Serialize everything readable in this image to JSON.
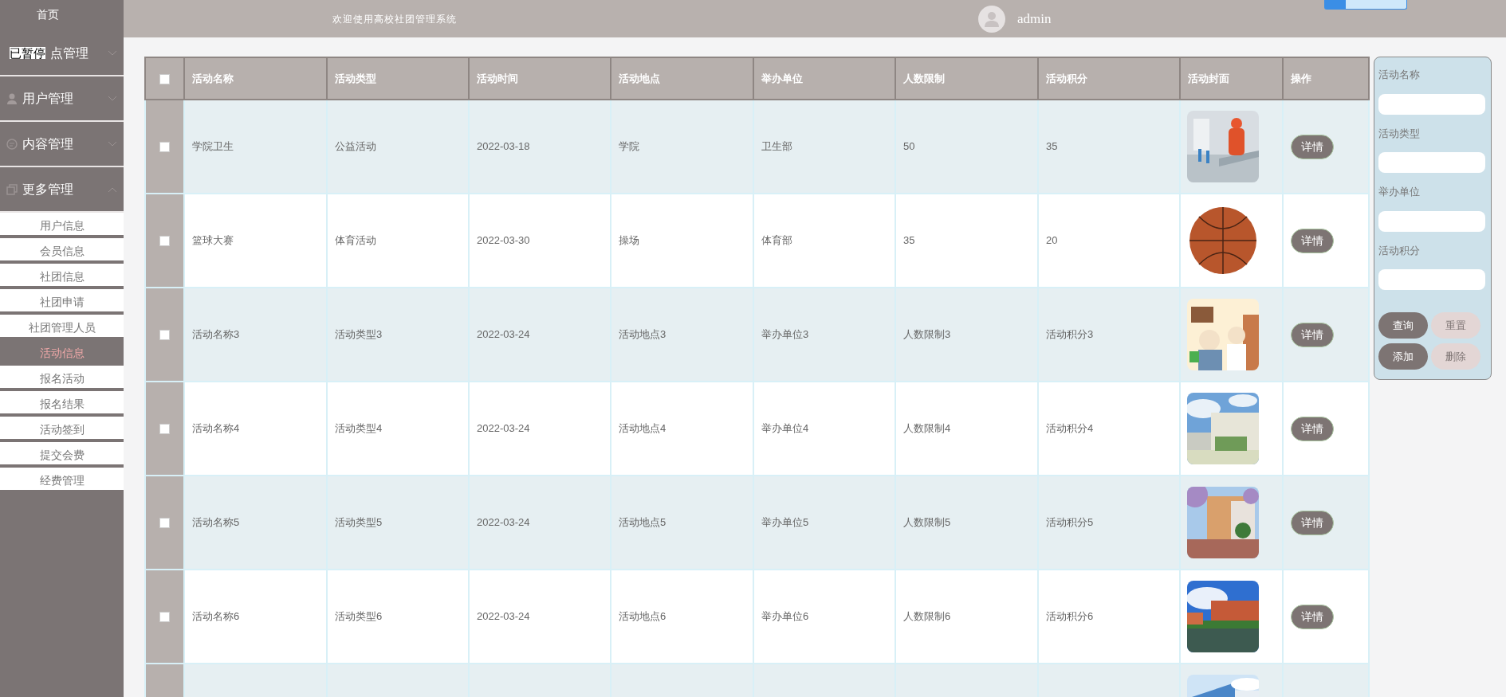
{
  "sidebar": {
    "home": "首页",
    "overlay": "已暂停",
    "groups": [
      {
        "label": "点管理",
        "expanded": false
      },
      {
        "label": "用户管理",
        "expanded": false
      },
      {
        "label": "内容管理",
        "expanded": false
      },
      {
        "label": "更多管理",
        "expanded": true,
        "items": [
          {
            "label": "用户信息",
            "selected": false
          },
          {
            "label": "会员信息",
            "selected": false
          },
          {
            "label": "社团信息",
            "selected": false
          },
          {
            "label": "社团申请",
            "selected": false
          },
          {
            "label": "社团管理人员",
            "selected": false
          },
          {
            "label": "活动信息",
            "selected": true
          },
          {
            "label": "报名活动",
            "selected": false
          },
          {
            "label": "报名结果",
            "selected": false
          },
          {
            "label": "活动签到",
            "selected": false
          },
          {
            "label": "提交会费",
            "selected": false
          },
          {
            "label": "经费管理",
            "selected": false
          }
        ]
      }
    ]
  },
  "header": {
    "title": "欢迎使用高校社团管理系统",
    "user": "admin"
  },
  "table": {
    "select_all_checked": false,
    "columns": [
      "活动名称",
      "活动类型",
      "活动时间",
      "活动地点",
      "举办单位",
      "人数限制",
      "活动积分",
      "活动封面",
      "操作"
    ],
    "rows": [
      {
        "checked": false,
        "cells": [
          "学院卫生",
          "公益活动",
          "2022-03-18",
          "学院",
          "卫生部",
          "50",
          "35"
        ],
        "action": "详情"
      },
      {
        "checked": false,
        "cells": [
          "篮球大赛",
          "体育活动",
          "2022-03-30",
          "操场",
          "体育部",
          "35",
          "20"
        ],
        "action": "详情"
      },
      {
        "checked": false,
        "cells": [
          "活动名称3",
          "活动类型3",
          "2022-03-24",
          "活动地点3",
          "举办单位3",
          "人数限制3",
          "活动积分3"
        ],
        "action": "详情"
      },
      {
        "checked": false,
        "cells": [
          "活动名称4",
          "活动类型4",
          "2022-03-24",
          "活动地点4",
          "举办单位4",
          "人数限制4",
          "活动积分4"
        ],
        "action": "详情"
      },
      {
        "checked": false,
        "cells": [
          "活动名称5",
          "活动类型5",
          "2022-03-24",
          "活动地点5",
          "举办单位5",
          "人数限制5",
          "活动积分5"
        ],
        "action": "详情"
      },
      {
        "checked": false,
        "cells": [
          "活动名称6",
          "活动类型6",
          "2022-03-24",
          "活动地点6",
          "举办单位6",
          "人数限制6",
          "活动积分6"
        ],
        "action": "详情"
      },
      {
        "cells": []
      }
    ]
  },
  "search_panel": {
    "fields": [
      {
        "label": "活动名称"
      },
      {
        "label": "活动类型"
      },
      {
        "label": "举办单位"
      },
      {
        "label": "活动积分"
      }
    ],
    "buttons": [
      {
        "label": "查询",
        "kind": "dark"
      },
      {
        "label": "重置",
        "kind": "light"
      },
      {
        "label": "添加",
        "kind": "dark"
      },
      {
        "label": "删除",
        "kind": "light"
      }
    ]
  }
}
